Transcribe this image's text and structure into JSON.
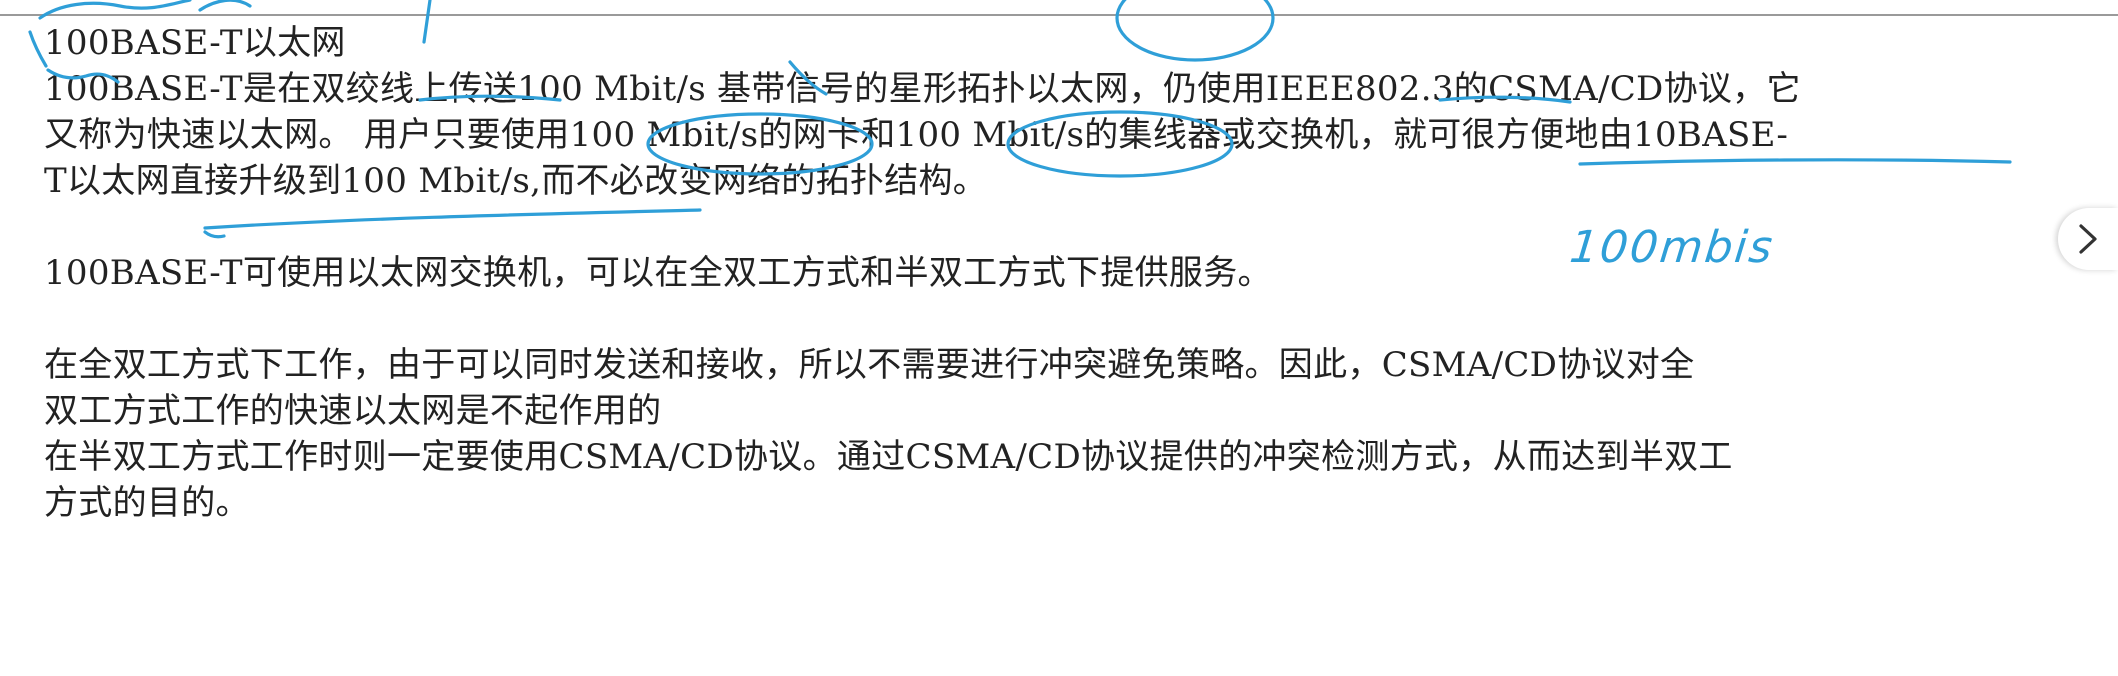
{
  "document": {
    "title": "100BASE-T以太网",
    "paragraph_1": {
      "line_1": "100BASE-T是在双绞线上传送100 Mbit/s 基带信号的星形拓扑以太网，仍使用IEEE802.3的CSMA/CD协议，它",
      "line_2": "又称为快速以太网。 用户只要使用100 Mbit/s的网卡和100 Mbit/s的集线器或交换机，就可很方便地由10BASE-",
      "line_3": "T以太网直接升级到100 Mbit/s,而不必改变网络的拓扑结构。"
    },
    "paragraph_2": {
      "line_1": "100BASE-T可使用以太网交换机，可以在全双工方式和半双工方式下提供服务。"
    },
    "paragraph_3": {
      "line_1": "在全双工方式下工作，由于可以同时发送和接收，所以不需要进行冲突避免策略。因此，CSMA/CD协议对全",
      "line_2": "双工方式工作的快速以太网是不起作用的",
      "line_3": "在半双工方式工作时则一定要使用CSMA/CD协议。通过CSMA/CD协议提供的冲突检测方式，从而达到半双工",
      "line_4": "方式的目的。"
    }
  },
  "annotations": {
    "handwritten_note": "100mbis",
    "ink_color": "#2f9fd8"
  },
  "navigation": {
    "next_icon": "chevron-right-icon"
  }
}
